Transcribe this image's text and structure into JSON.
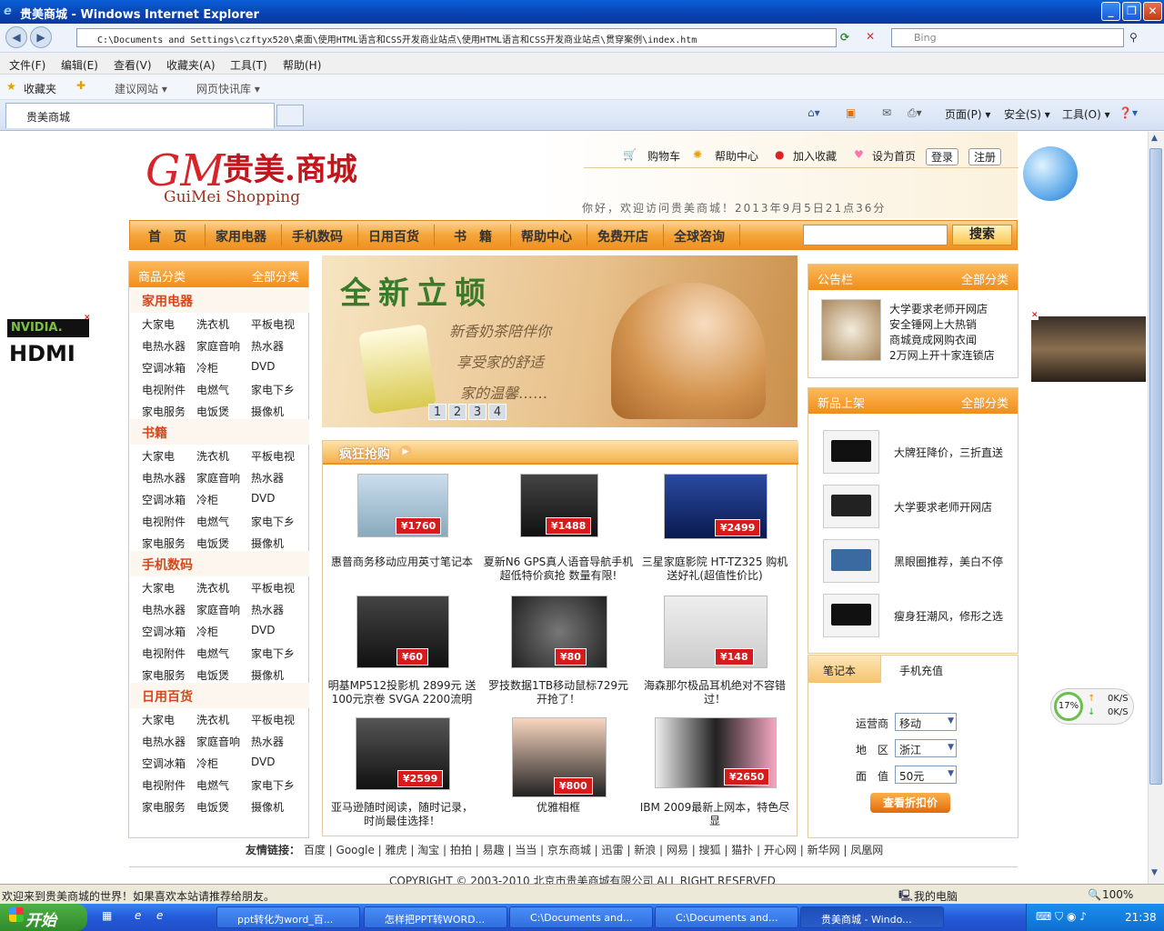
{
  "window": {
    "title": "贵美商城 - Windows Internet Explorer"
  },
  "address": {
    "url": "C:\\Documents and Settings\\czftyx520\\桌面\\使用HTML语言和CSS开发商业站点\\使用HTML语言和CSS开发商业站点\\贯穿案例\\index.htm",
    "search_placeholder": "Bing"
  },
  "menu": [
    "文件(F)",
    "编辑(E)",
    "查看(V)",
    "收藏夹(A)",
    "工具(T)",
    "帮助(H)"
  ],
  "favorites": {
    "label": "收藏夹",
    "items": [
      "建议网站 ▾",
      "网页快讯库 ▾"
    ]
  },
  "tab": {
    "title": "贵美商城"
  },
  "cmdbar": [
    "页面(P) ▾",
    "安全(S) ▾",
    "工具(O) ▾"
  ],
  "page": {
    "logo": {
      "m": "GM",
      "cn": "贵美.商城",
      "en": "GuiMei Shopping"
    },
    "toplinks": [
      "购物车",
      "帮助中心",
      "加入收藏",
      "设为首页",
      "登录",
      "注册"
    ],
    "welcome": "你好，欢迎访问贵美商城！2013年9月5日21点36分",
    "nav": [
      "首　页",
      "家用电器",
      "手机数码",
      "日用百货",
      "书　籍",
      "帮助中心",
      "免费开店",
      "全球咨询"
    ],
    "search_btn": "搜索",
    "categories": {
      "header": "商品分类",
      "all": "全部分类",
      "groups": [
        {
          "title": "家用电器"
        },
        {
          "title": "书籍"
        },
        {
          "title": "手机数码"
        },
        {
          "title": "日用百货"
        }
      ],
      "items": [
        "大家电",
        "洗衣机",
        "平板电视",
        "电热水器",
        "家庭音响",
        "热水器",
        "空调冰箱",
        "冷柜",
        "DVD",
        "电视附件",
        "电燃气",
        "家电下乡",
        "家电服务",
        "电饭煲",
        "摄像机"
      ]
    },
    "banner": {
      "title": "全新立顿",
      "lines": [
        "新香奶茶陪伴你",
        "享受家的舒适",
        "家的温馨……"
      ],
      "pages": [
        "1",
        "2",
        "3",
        "4"
      ]
    },
    "crazy": {
      "title": "疯狂抢购",
      "products": [
        {
          "name": "惠普商务移动应用英寸笔记本",
          "price": "¥1760"
        },
        {
          "name": "夏新N6 GPS真人语音导航手机超低特价疯抢 数量有限!",
          "price": "¥1488"
        },
        {
          "name": "三星家庭影院 HT-TZ325 购机送好礼(超值性价比)",
          "price": "¥2499"
        },
        {
          "name": "明基MP512投影机 2899元 送100元京卷 SVGA 2200流明",
          "price": "¥60"
        },
        {
          "name": "罗技数据1TB移动鼠标729元开抢了！",
          "price": "¥80"
        },
        {
          "name": "海森那尔极品耳机绝对不容错过！",
          "price": "¥148"
        },
        {
          "name": "亚马逊随时阅读，随时记录，时尚最佳选择！",
          "price": "¥2599"
        },
        {
          "name": "优雅相框",
          "price": "¥800"
        },
        {
          "name": "IBM 2009最新上网本，特色尽显",
          "price": "¥2650"
        }
      ]
    },
    "notice": {
      "header": "公告栏",
      "all": "全部分类",
      "items": [
        "大学要求老师开网店",
        "安全锤网上大热销",
        "商城竟成网购衣闻",
        "2万网上开十家连锁店"
      ]
    },
    "newgoods": {
      "header": "新品上架",
      "all": "全部分类",
      "items": [
        "大牌狂降价，三折直送",
        "大学要求老师开网店",
        "黑眼圈推荐，美白不停",
        "瘦身狂潮风，修形之选"
      ]
    },
    "phone": {
      "tabs": [
        "笔记本",
        "手机充值"
      ],
      "labels": [
        "运营商",
        "地　区",
        "面　值"
      ],
      "values": [
        "移动",
        "浙江",
        "50元"
      ],
      "btn": "查看折扣价"
    },
    "footer": {
      "label": "友情链接：",
      "links": "百度 | Google | 雅虎 | 淘宝 | 拍拍 | 易趣 | 当当 | 京东商城 | 迅雷 | 新浪 | 网易 | 搜狐 | 猫扑 | 开心网 | 新华网 | 凤凰网",
      "copyright": "COPYRIGHT © 2003-2010 北京市贵美商城有限公司 ALL RIGHT RESERVED"
    },
    "net": {
      "percent": "17%",
      "up": "0K/S",
      "down": "0K/S"
    }
  },
  "status": {
    "text": "欢迎来到贵美商城的世界！如果喜欢本站请推荐给朋友。",
    "zone": "我的电脑",
    "zoom": "100%"
  },
  "taskbar": {
    "start": "开始",
    "tasks": [
      "ppt转化为word_百...",
      "怎样把PPT转WORD...",
      "C:\\Documents and...",
      "C:\\Documents and...",
      "贵美商城 - Windo..."
    ],
    "clock": "21:38"
  }
}
